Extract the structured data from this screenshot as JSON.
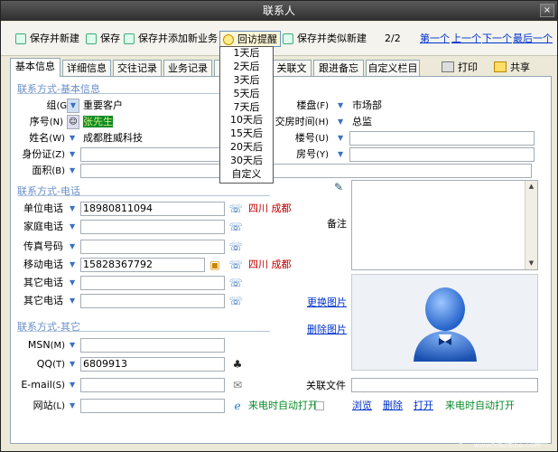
{
  "window": {
    "title": "联系人",
    "close": "×"
  },
  "toolbar": {
    "save_new": "保存并新建",
    "save": "保存",
    "save_add_business": "保存并添加新业务",
    "reminder": "回访提醒",
    "save_new_similar": "保存并类似新建",
    "page": "2/2",
    "first": "第一个",
    "prev": "上一个",
    "next": "下一个",
    "last": "最后一个"
  },
  "reminder_menu": [
    "1天后",
    "2天后",
    "3天后",
    "5天后",
    "7天后",
    "10天后",
    "15天后",
    "20天后",
    "30天后",
    "自定义"
  ],
  "tabs": [
    "基本信息",
    "详细信息",
    "交往记录",
    "业务记录",
    "",
    "关联文件",
    "跟进备忘",
    "自定义栏目"
  ],
  "tab_buttons": {
    "print": "打印",
    "share": "共享"
  },
  "sections": {
    "basic": "联系方式-基本信息",
    "phone": "联系方式-电话",
    "other": "联系方式-其它"
  },
  "basic": {
    "group_label": "组",
    "group_key": "(G)",
    "group_value": "重要客户",
    "serial_label": "序号",
    "serial_key": "(N)",
    "serial_value": "张先生",
    "name_label": "姓名",
    "name_key": "(W)",
    "name_value": "成都胜威科技",
    "id_label": "身份证",
    "id_key": "(Z)",
    "id_value": "",
    "area_label": "面积",
    "area_key": "(B)",
    "area_value": "",
    "floor_label": "楼盘",
    "floor_key": "(F)",
    "floor_value": "市场部",
    "deal_label": "交房时间",
    "deal_key": "(H)",
    "deal_value": "总监",
    "building_label": "楼号",
    "building_key": "(U)",
    "building_value": "",
    "room_label": "房号",
    "room_key": "(Y)",
    "room_value": ""
  },
  "phones": {
    "work_label": "单位电话",
    "work_value": "18980811094",
    "work_loc": "四川 成都",
    "home_label": "家庭电话",
    "home_value": "",
    "fax_label": "传真号码",
    "fax_value": "",
    "mobile_label": "移动电话",
    "mobile_value": "15828367792",
    "mobile_loc": "四川 成都",
    "other1_label": "其它电话",
    "other1_value": "",
    "other2_label": "其它电话",
    "other2_value": ""
  },
  "other": {
    "msn_label": "MSN",
    "msn_key": "(M)",
    "msn_value": "",
    "qq_label": "QQ",
    "qq_key": "(T)",
    "qq_value": "6809913",
    "email_label": "E-mail",
    "email_key": "(S)",
    "email_value": "",
    "web_label": "网站",
    "web_key": "(L)",
    "web_value": ""
  },
  "right": {
    "notes_label": "备注",
    "change_photo": "更换图片",
    "delete_photo": "删除图片",
    "linked_file_label": "关联文件",
    "browse": "浏览",
    "delete": "删除",
    "open": "打开",
    "auto_popup": "来电时自动打开",
    "auto_popup2": "来电时自动打开"
  },
  "watermark": {
    "text": "下载吧",
    "url": "www.xiazaiba.com"
  }
}
